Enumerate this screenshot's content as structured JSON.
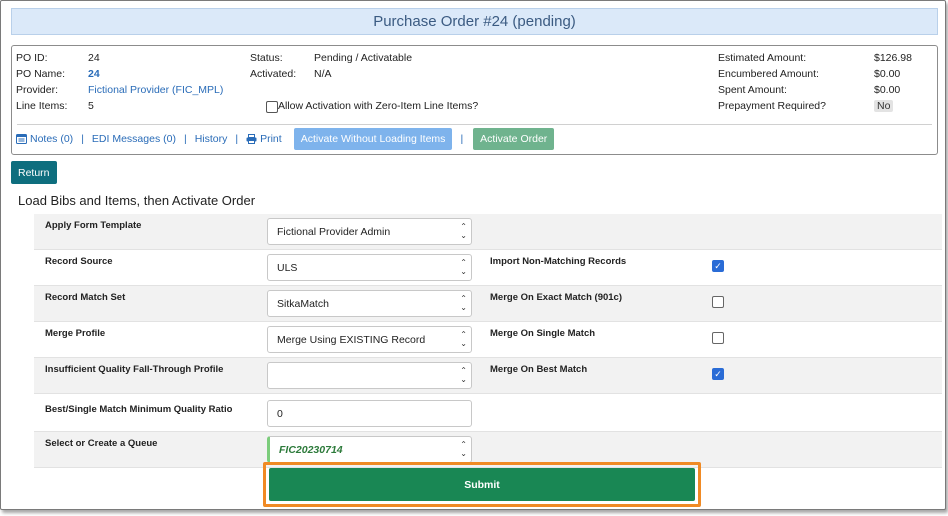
{
  "header": {
    "title": "Purchase Order #24 (pending)"
  },
  "summary": {
    "po_id_label": "PO ID:",
    "po_id": "24",
    "po_name_label": "PO Name:",
    "po_name": "24",
    "provider_label": "Provider:",
    "provider": "Fictional Provider (FIC_MPL)",
    "line_items_label": "Line Items:",
    "line_items": "5",
    "status_label": "Status:",
    "status": "Pending / Activatable",
    "activated_label": "Activated:",
    "activated": "N/A",
    "zero_item_label": "Allow Activation with Zero-Item Line Items?",
    "estimated_label": "Estimated Amount:",
    "estimated": "$126.98",
    "encumbered_label": "Encumbered Amount:",
    "encumbered": "$0.00",
    "spent_label": "Spent Amount:",
    "spent": "$0.00",
    "prepayment_label": "Prepayment Required?",
    "prepayment": "No"
  },
  "actions": {
    "notes": "Notes (0)",
    "edi": "EDI Messages (0)",
    "history": "History",
    "print": "Print",
    "activate_without": "Activate Without Loading Items",
    "activate_order": "Activate Order"
  },
  "return_label": "Return",
  "section_title": "Load Bibs and Items, then Activate Order",
  "form": {
    "apply_template_label": "Apply Form Template",
    "apply_template_value": "Fictional Provider Admin",
    "record_source_label": "Record Source",
    "record_source_value": "ULS",
    "record_match_label": "Record Match Set",
    "record_match_value": "SitkaMatch",
    "merge_profile_label": "Merge Profile",
    "merge_profile_value": "Merge Using EXISTING Record",
    "insufficient_label": "Insufficient Quality Fall-Through Profile",
    "insufficient_value": "",
    "min_quality_label": "Best/Single Match Minimum Quality Ratio",
    "min_quality_value": "0",
    "queue_label": "Select or Create a Queue",
    "queue_value": "FIC20230714",
    "import_nonmatching_label": "Import Non-Matching Records",
    "merge_exact_label": "Merge On Exact Match (901c)",
    "merge_single_label": "Merge On Single Match",
    "merge_best_label": "Merge On Best Match",
    "import_nonmatching_checked": true,
    "merge_exact_checked": false,
    "merge_single_checked": false,
    "merge_best_checked": true
  },
  "submit_label": "Submit",
  "colors": {
    "title_bg": "#dbe9f9",
    "link": "#2a6cb8",
    "return_bg": "#0e6e7e",
    "submit_bg": "#198754",
    "highlight": "#f08a24",
    "checkbox_on": "#2a6cd6"
  }
}
